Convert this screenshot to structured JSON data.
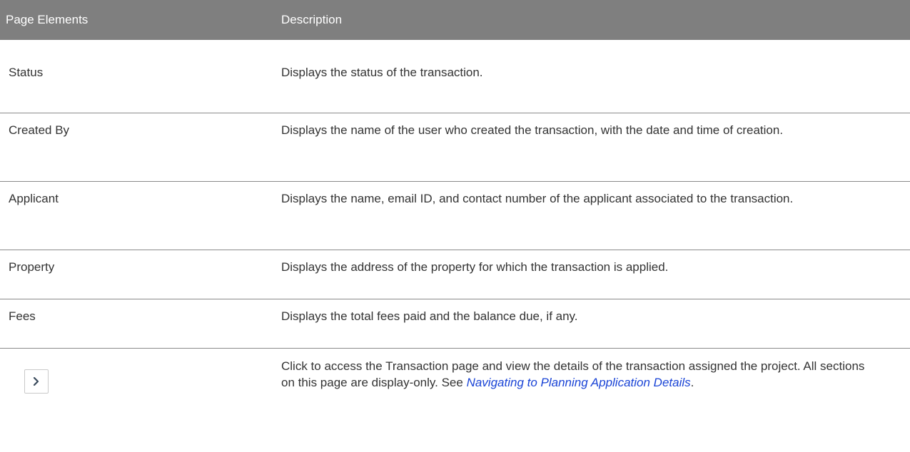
{
  "table": {
    "headers": {
      "elements": "Page Elements",
      "description": "Description"
    },
    "rows": [
      {
        "element": "Status",
        "description": "Displays the status of the transaction."
      },
      {
        "element": "Created By",
        "description": "Displays the name of the user who created the transaction, with the date and time of creation."
      },
      {
        "element": "Applicant",
        "description": "Displays the name, email ID, and contact number of the applicant associated to the transaction."
      },
      {
        "element": "Property",
        "description": "Displays the address of the property for which the transaction is applied."
      },
      {
        "element": "Fees",
        "description": "Displays the total fees paid and the balance due, if any."
      }
    ],
    "last_row": {
      "icon": "chevron-right-icon",
      "description_before": "Click to access the Transaction page and view the details of the transaction assigned the project. All sections on this page are display-only. See ",
      "link_text": "Navigating to Planning Application Details",
      "description_after": "."
    }
  }
}
